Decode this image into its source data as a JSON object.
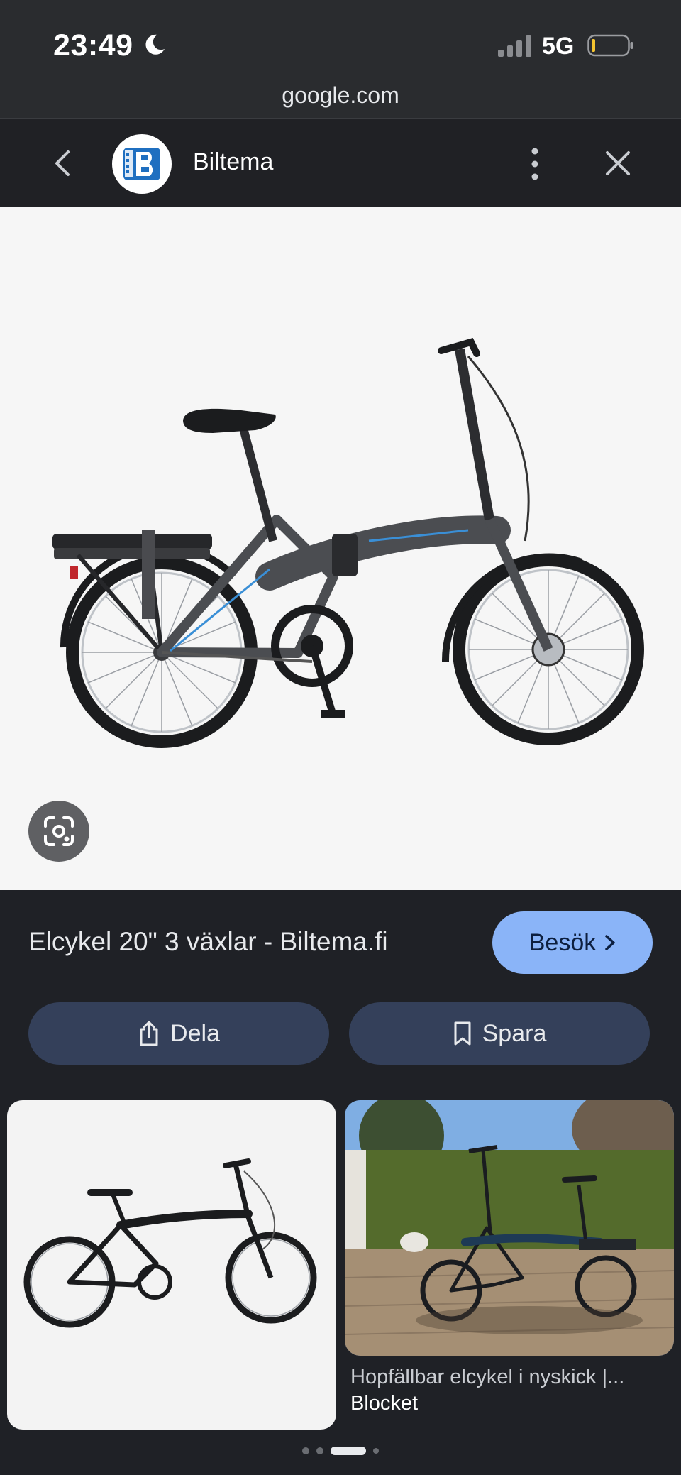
{
  "status_bar": {
    "time": "23:49",
    "network": "5G",
    "icons": [
      "moon-icon",
      "signal-icon",
      "battery-icon"
    ],
    "battery_level": 0.1
  },
  "url_bar": {
    "url": "google.com"
  },
  "header": {
    "site_name": "Biltema",
    "icons": [
      "back-icon",
      "biltema-logo",
      "more-vert-icon",
      "close-icon"
    ]
  },
  "main": {
    "image_icon": "bicycle-image",
    "lens_icon": "lens-icon"
  },
  "info": {
    "title": "Elcykel 20\" 3 växlar - Biltema.fi",
    "visit_label": "Besök",
    "share_label": "Dela",
    "save_label": "Spara"
  },
  "related": [
    {
      "caption": "",
      "source": ""
    },
    {
      "caption": "Hopfällbar elcykel i nyskick |...",
      "source": "Blocket"
    }
  ],
  "pager": {
    "count": 4,
    "active_index": 2
  },
  "colors": {
    "background": "#1f2126",
    "accent": "#8ab4f8",
    "action_button": "#34405a",
    "bike_blue": "#3a8fd6"
  }
}
